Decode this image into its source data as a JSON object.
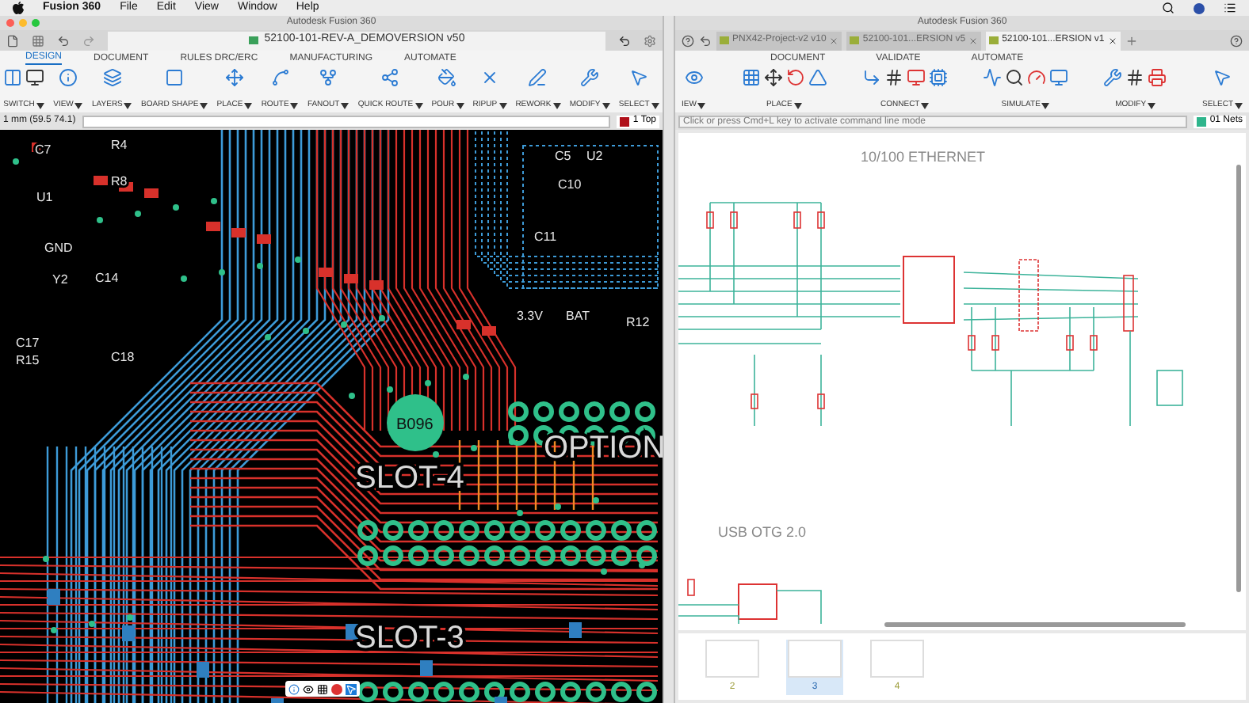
{
  "menu_bar": {
    "app": "Fusion 360",
    "items": [
      "File",
      "Edit",
      "View",
      "Window",
      "Help"
    ]
  },
  "pcb_window": {
    "title": "Autodesk Fusion 360",
    "tabs": [
      {
        "label": "52100-101-REV-A_DEMOVERSION v50",
        "selected": true
      }
    ],
    "ribbon_tabs": [
      {
        "label": "DESIGN",
        "selected": true
      },
      {
        "label": "DOCUMENT",
        "selected": false
      },
      {
        "label": "RULES DRC/ERC",
        "selected": false
      },
      {
        "label": "MANUFACTURING",
        "selected": false
      },
      {
        "label": "AUTOMATE",
        "selected": false
      }
    ],
    "tools": [
      "SWITCH",
      "VIEW",
      "LAYERS",
      "BOARD SHAPE",
      "PLACE",
      "ROUTE",
      "FANOUT",
      "QUICK ROUTE",
      "POUR",
      "RIPUP",
      "REWORK",
      "MODIFY",
      "SELECT"
    ],
    "coordinates": "1 mm (59.5 74.1)",
    "layer": "1 Top",
    "board_labels": [
      "C7",
      "R4",
      "U1",
      "R8",
      "GND",
      "Y2",
      "C14",
      "C17",
      "R15",
      "C18",
      "C5",
      "U2",
      "C10",
      "C11",
      "3.3V",
      "BAT",
      "R12",
      "B096",
      "OPTION",
      "SLOT-4",
      "SLOT-3"
    ]
  },
  "schematic_window": {
    "title": "Autodesk Fusion 360",
    "tabs": [
      {
        "label": "PNX42-Project-v2 v10",
        "selected": false
      },
      {
        "label": "52100-101...ERSION v5",
        "selected": false
      },
      {
        "label": "52100-101...ERSION v1",
        "selected": true
      }
    ],
    "ribbon_tabs": [
      {
        "label": "DOCUMENT",
        "selected": false
      },
      {
        "label": "VALIDATE",
        "selected": false
      },
      {
        "label": "AUTOMATE",
        "selected": false
      }
    ],
    "tools": [
      "IEW",
      "PLACE",
      "CONNECT",
      "SIMULATE",
      "MODIFY",
      "SELECT"
    ],
    "command_placeholder": "Click or press Cmd+L key to activate command line mode",
    "nets": "01 Nets",
    "sheet_titles": [
      "10/100 ETHERNET",
      "USB OTG 2.0"
    ],
    "pages": [
      {
        "label": "2",
        "selected": false
      },
      {
        "label": "3",
        "selected": true
      },
      {
        "label": "4",
        "selected": false
      }
    ]
  }
}
